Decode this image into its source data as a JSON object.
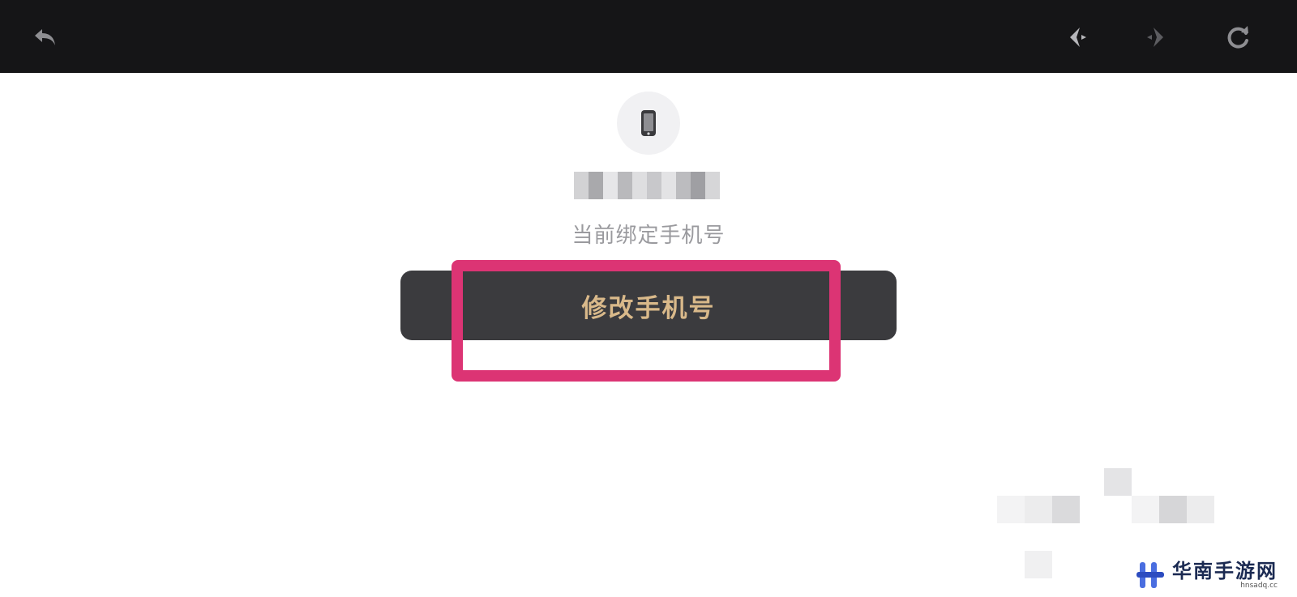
{
  "topbar": {
    "icons": [
      "back-arrow-icon",
      "previous-icon",
      "next-icon",
      "refresh-icon"
    ]
  },
  "main": {
    "phone_icon": "phone-icon",
    "bound_label": "当前绑定手机号",
    "change_button_label": "修改手机号"
  },
  "colors": {
    "topbar_bg": "#151517",
    "button_bg": "#3b3b3e",
    "button_text": "#d9b98a",
    "highlight": "#dc3474"
  },
  "watermark": {
    "title": "华南手游网",
    "subtitle": "hnsadq.cc"
  }
}
